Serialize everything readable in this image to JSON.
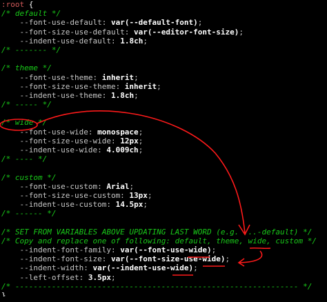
{
  "lines": [
    {
      "t": "sel",
      "sel": ":root",
      "brace": " {"
    },
    {
      "t": "c",
      "text": "/* default */"
    },
    {
      "t": "d",
      "prop": "    --font-use-default:",
      "val": " var(--default-font)",
      "end": ";"
    },
    {
      "t": "d",
      "prop": "    --font-size-use-default:",
      "val": " var(--editor-font-size)",
      "end": ";"
    },
    {
      "t": "d",
      "prop": "    --indent-use-default:",
      "val": " 1.8ch",
      "end": ";"
    },
    {
      "t": "c",
      "text": "/* ------- */"
    },
    {
      "t": "b"
    },
    {
      "t": "c",
      "text": "/* theme */"
    },
    {
      "t": "d",
      "prop": "    --font-use-theme:",
      "val": " inherit",
      "end": ";"
    },
    {
      "t": "d",
      "prop": "    --font-size-use-theme:",
      "val": " inherit",
      "end": ";"
    },
    {
      "t": "d",
      "prop": "    --indent-use-theme:",
      "val": " 1.8ch",
      "end": ";"
    },
    {
      "t": "c",
      "text": "/* ----- */"
    },
    {
      "t": "b"
    },
    {
      "t": "c",
      "text": "/* wide */"
    },
    {
      "t": "d",
      "prop": "    --font-use-wide:",
      "val": " monospace",
      "end": ";"
    },
    {
      "t": "d",
      "prop": "    --font-size-use-wide:",
      "val": " 12px",
      "end": ";"
    },
    {
      "t": "d",
      "prop": "    --indent-use-wide:",
      "val": " 4.009ch",
      "end": ";"
    },
    {
      "t": "c",
      "text": "/* ---- */"
    },
    {
      "t": "b"
    },
    {
      "t": "c",
      "text": "/* custom */"
    },
    {
      "t": "d",
      "prop": "    --font-use-custom:",
      "val": " Arial",
      "end": ";"
    },
    {
      "t": "d",
      "prop": "    --font-size-use-custom:",
      "val": " 13px",
      "end": ";"
    },
    {
      "t": "d",
      "prop": "    --indent-use-custom:",
      "val": " 14.5px",
      "end": ";"
    },
    {
      "t": "c",
      "text": "/* ------ */"
    },
    {
      "t": "b"
    },
    {
      "t": "c",
      "text": "/* SET FROM VARIABLES ABOVE UPDATING LAST WORD (e.g. ...-default) */"
    },
    {
      "t": "c",
      "text": "/* Copy and replace one of following: default, theme, wide, custom */"
    },
    {
      "t": "d",
      "prop": "    --indent-font-family:",
      "val": " var(--font-use-wide)",
      "end": ";"
    },
    {
      "t": "d",
      "prop": "    --indent-font-size:",
      "val": " var(--font-size-use-wide)",
      "end": ";"
    },
    {
      "t": "d",
      "prop": "    --indent-width:",
      "val": " var(--indent-use-wide)",
      "end": ";"
    },
    {
      "t": "d",
      "prop": "    --left-offset:",
      "val": " 3.5px",
      "end": ";"
    },
    {
      "t": "c",
      "text": "/* -------------------------------------------------------------- */"
    },
    {
      "t": "brace",
      "text": "}"
    }
  ],
  "colors": {
    "background": "#000000",
    "selector": "#d25a5a",
    "comment": "#19c919",
    "property": "#c8c8c8",
    "value": "#ffffff",
    "annotation": "#ff1a1a"
  }
}
